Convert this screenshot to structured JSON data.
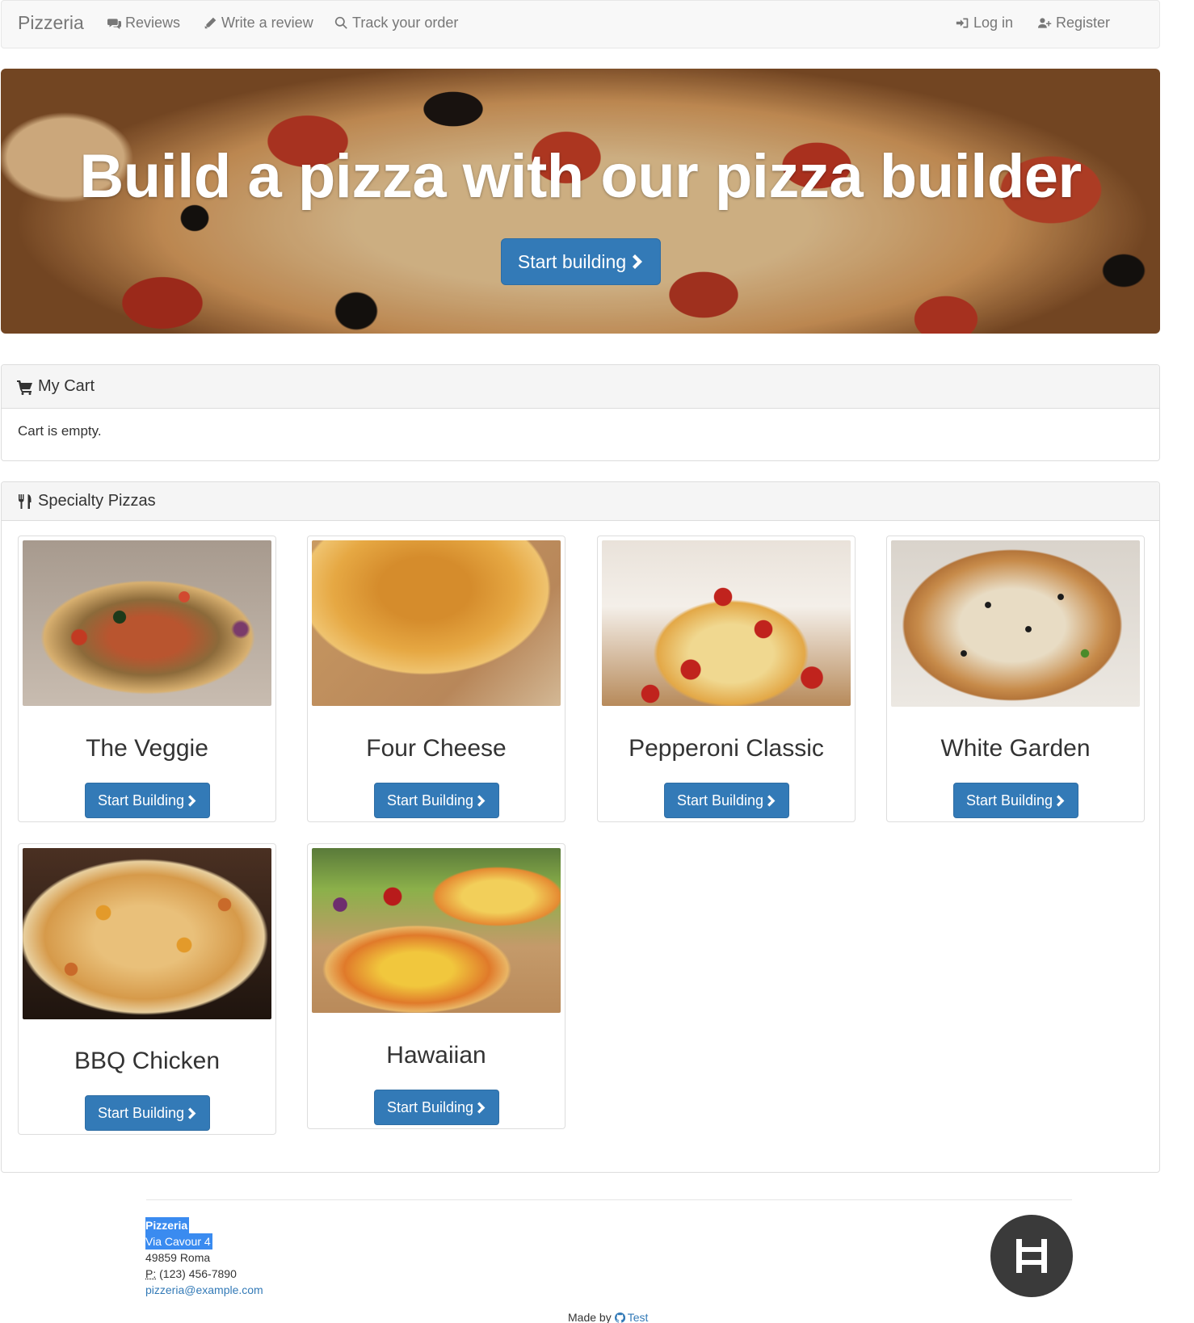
{
  "navbar": {
    "brand": "Pizzeria",
    "links": [
      {
        "label": "Reviews",
        "icon": "comments-icon"
      },
      {
        "label": "Write a review",
        "icon": "pencil-icon"
      },
      {
        "label": "Track your order",
        "icon": "search-icon"
      }
    ],
    "right_links": [
      {
        "label": "Log in",
        "icon": "log-in-icon"
      },
      {
        "label": "Register",
        "icon": "user-add-icon"
      }
    ]
  },
  "hero": {
    "title": "Build a pizza with our pizza builder",
    "button_label": "Start building",
    "button_icon": "chevron-right-icon"
  },
  "cart": {
    "heading": "My Cart",
    "heading_icon": "shopping-cart-icon",
    "empty_text": "Cart is empty."
  },
  "specialty": {
    "heading": "Specialty Pizzas",
    "heading_icon": "cutlery-icon",
    "pizzas": [
      {
        "name": "The Veggie",
        "button_label": "Start Building"
      },
      {
        "name": "Four Cheese",
        "button_label": "Start Building"
      },
      {
        "name": "Pepperoni Classic",
        "button_label": "Start Building"
      },
      {
        "name": "White Garden",
        "button_label": "Start Building"
      },
      {
        "name": "BBQ Chicken",
        "button_label": "Start Building"
      },
      {
        "name": "Hawaiian",
        "button_label": "Start Building"
      }
    ]
  },
  "footer": {
    "company": "Pizzeria",
    "street": "Via Cavour 4",
    "city": "49859 Roma",
    "phone_abbr": "P:",
    "phone": "(123) 456-7890",
    "email": "pizzeria@example.com",
    "made_by_text": "Made by",
    "made_by_link": "Test",
    "made_by_icon": "github-icon",
    "logo_icon": "h-logo-icon"
  },
  "colors": {
    "primary": "#337ab7",
    "navbar_bg": "#f8f8f8",
    "panel_heading_bg": "#f5f5f5",
    "selection_highlight": "#3a8bf0"
  }
}
